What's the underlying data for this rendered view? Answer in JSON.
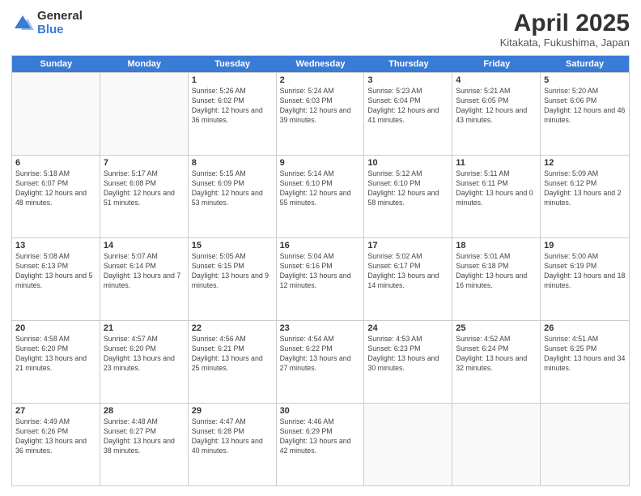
{
  "logo": {
    "general": "General",
    "blue": "Blue"
  },
  "title": {
    "month": "April 2025",
    "location": "Kitakata, Fukushima, Japan"
  },
  "header": {
    "days": [
      "Sunday",
      "Monday",
      "Tuesday",
      "Wednesday",
      "Thursday",
      "Friday",
      "Saturday"
    ]
  },
  "weeks": [
    [
      {
        "day": "",
        "info": ""
      },
      {
        "day": "",
        "info": ""
      },
      {
        "day": "1",
        "info": "Sunrise: 5:26 AM\nSunset: 6:02 PM\nDaylight: 12 hours and 36 minutes."
      },
      {
        "day": "2",
        "info": "Sunrise: 5:24 AM\nSunset: 6:03 PM\nDaylight: 12 hours and 39 minutes."
      },
      {
        "day": "3",
        "info": "Sunrise: 5:23 AM\nSunset: 6:04 PM\nDaylight: 12 hours and 41 minutes."
      },
      {
        "day": "4",
        "info": "Sunrise: 5:21 AM\nSunset: 6:05 PM\nDaylight: 12 hours and 43 minutes."
      },
      {
        "day": "5",
        "info": "Sunrise: 5:20 AM\nSunset: 6:06 PM\nDaylight: 12 hours and 46 minutes."
      }
    ],
    [
      {
        "day": "6",
        "info": "Sunrise: 5:18 AM\nSunset: 6:07 PM\nDaylight: 12 hours and 48 minutes."
      },
      {
        "day": "7",
        "info": "Sunrise: 5:17 AM\nSunset: 6:08 PM\nDaylight: 12 hours and 51 minutes."
      },
      {
        "day": "8",
        "info": "Sunrise: 5:15 AM\nSunset: 6:09 PM\nDaylight: 12 hours and 53 minutes."
      },
      {
        "day": "9",
        "info": "Sunrise: 5:14 AM\nSunset: 6:10 PM\nDaylight: 12 hours and 55 minutes."
      },
      {
        "day": "10",
        "info": "Sunrise: 5:12 AM\nSunset: 6:10 PM\nDaylight: 12 hours and 58 minutes."
      },
      {
        "day": "11",
        "info": "Sunrise: 5:11 AM\nSunset: 6:11 PM\nDaylight: 13 hours and 0 minutes."
      },
      {
        "day": "12",
        "info": "Sunrise: 5:09 AM\nSunset: 6:12 PM\nDaylight: 13 hours and 2 minutes."
      }
    ],
    [
      {
        "day": "13",
        "info": "Sunrise: 5:08 AM\nSunset: 6:13 PM\nDaylight: 13 hours and 5 minutes."
      },
      {
        "day": "14",
        "info": "Sunrise: 5:07 AM\nSunset: 6:14 PM\nDaylight: 13 hours and 7 minutes."
      },
      {
        "day": "15",
        "info": "Sunrise: 5:05 AM\nSunset: 6:15 PM\nDaylight: 13 hours and 9 minutes."
      },
      {
        "day": "16",
        "info": "Sunrise: 5:04 AM\nSunset: 6:16 PM\nDaylight: 13 hours and 12 minutes."
      },
      {
        "day": "17",
        "info": "Sunrise: 5:02 AM\nSunset: 6:17 PM\nDaylight: 13 hours and 14 minutes."
      },
      {
        "day": "18",
        "info": "Sunrise: 5:01 AM\nSunset: 6:18 PM\nDaylight: 13 hours and 16 minutes."
      },
      {
        "day": "19",
        "info": "Sunrise: 5:00 AM\nSunset: 6:19 PM\nDaylight: 13 hours and 18 minutes."
      }
    ],
    [
      {
        "day": "20",
        "info": "Sunrise: 4:58 AM\nSunset: 6:20 PM\nDaylight: 13 hours and 21 minutes."
      },
      {
        "day": "21",
        "info": "Sunrise: 4:57 AM\nSunset: 6:20 PM\nDaylight: 13 hours and 23 minutes."
      },
      {
        "day": "22",
        "info": "Sunrise: 4:56 AM\nSunset: 6:21 PM\nDaylight: 13 hours and 25 minutes."
      },
      {
        "day": "23",
        "info": "Sunrise: 4:54 AM\nSunset: 6:22 PM\nDaylight: 13 hours and 27 minutes."
      },
      {
        "day": "24",
        "info": "Sunrise: 4:53 AM\nSunset: 6:23 PM\nDaylight: 13 hours and 30 minutes."
      },
      {
        "day": "25",
        "info": "Sunrise: 4:52 AM\nSunset: 6:24 PM\nDaylight: 13 hours and 32 minutes."
      },
      {
        "day": "26",
        "info": "Sunrise: 4:51 AM\nSunset: 6:25 PM\nDaylight: 13 hours and 34 minutes."
      }
    ],
    [
      {
        "day": "27",
        "info": "Sunrise: 4:49 AM\nSunset: 6:26 PM\nDaylight: 13 hours and 36 minutes."
      },
      {
        "day": "28",
        "info": "Sunrise: 4:48 AM\nSunset: 6:27 PM\nDaylight: 13 hours and 38 minutes."
      },
      {
        "day": "29",
        "info": "Sunrise: 4:47 AM\nSunset: 6:28 PM\nDaylight: 13 hours and 40 minutes."
      },
      {
        "day": "30",
        "info": "Sunrise: 4:46 AM\nSunset: 6:29 PM\nDaylight: 13 hours and 42 minutes."
      },
      {
        "day": "",
        "info": ""
      },
      {
        "day": "",
        "info": ""
      },
      {
        "day": "",
        "info": ""
      }
    ]
  ]
}
